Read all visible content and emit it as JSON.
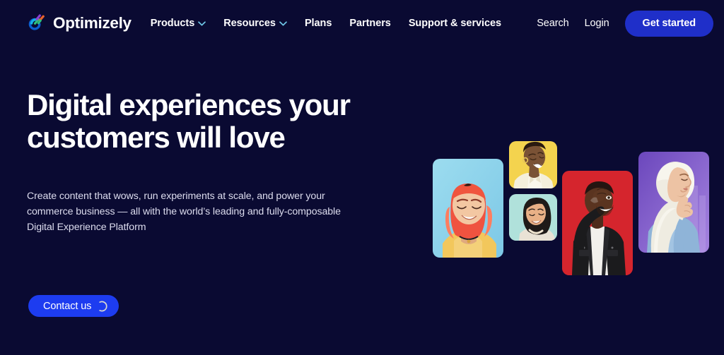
{
  "theme": {
    "page_background": "#0a0a32",
    "accent_primary": "#1f2fc9",
    "accent_bright": "#1d3cf0",
    "text_primary": "#ffffff",
    "text_muted": "#dcdcee",
    "chevron_color": "#6fc7e8"
  },
  "header": {
    "brand": {
      "name": "Optimizely",
      "logo_icon": "optimizely-logo-icon",
      "logo_colors": {
        "arc": "#0b5fd1",
        "green": "#2fbf7e",
        "purple": "#8b3fd4",
        "orange": "#e8612c",
        "cyan": "#13b4e8"
      }
    },
    "nav": [
      {
        "label": "Products",
        "has_dropdown": true,
        "icon": "chevron-down-icon"
      },
      {
        "label": "Resources",
        "has_dropdown": true,
        "icon": "chevron-down-icon"
      },
      {
        "label": "Plans",
        "has_dropdown": false,
        "icon": ""
      },
      {
        "label": "Partners",
        "has_dropdown": false,
        "icon": ""
      },
      {
        "label": "Support & services",
        "has_dropdown": false,
        "icon": ""
      }
    ],
    "search_label": "Search",
    "login_label": "Login",
    "get_started_label": "Get started"
  },
  "hero": {
    "headline": "Digital experiences your customers will love",
    "subtext": "Create content that wows, run experiments at scale, and power your commerce business — all with the world’s leading and fully-composable Digital Experience Platform",
    "cta": {
      "label": "Contact us",
      "icon": "loading-spinner-icon"
    }
  },
  "collage": {
    "cards": [
      {
        "id": "card-1",
        "alt": "Smiling person with pink hair in yellow top",
        "background": "#8ed4ec",
        "background_alt": "#a7dff0",
        "skin": "#f1c39e",
        "hair": "#f0553e",
        "hair_alt": "#ff7a5c",
        "clothing": "#f2c75c"
      },
      {
        "id": "card-2",
        "alt": "Laughing person in cream jacket",
        "background": "#f3d045",
        "background_alt": "#f7dc6c",
        "skin": "#6f4a30",
        "hair": "#2a1a10",
        "clothing": "#f4efdc"
      },
      {
        "id": "card-3",
        "alt": "Smiling person with dark hair",
        "background": "#a5dcd6",
        "background_alt": "#bfe8e2",
        "skin": "#e0a97d",
        "hair": "#1f1a18",
        "clothing": "#e9e2d5"
      },
      {
        "id": "card-4",
        "alt": "Laughing person in black jacket on red background",
        "background": "#cc1f28",
        "background_alt": "#e02c33",
        "skin": "#5a3420",
        "hair": "#241511",
        "clothing": "#1b1b1d",
        "clothing_alt": "#f2f0ec"
      },
      {
        "id": "card-5",
        "alt": "Person in white hijab and blue top on purple background",
        "background": "#7a56c4",
        "background_alt": "#9b7ad8",
        "skin": "#edc3a4",
        "hair": "#f2efe6",
        "clothing": "#8fb4d8"
      }
    ]
  }
}
